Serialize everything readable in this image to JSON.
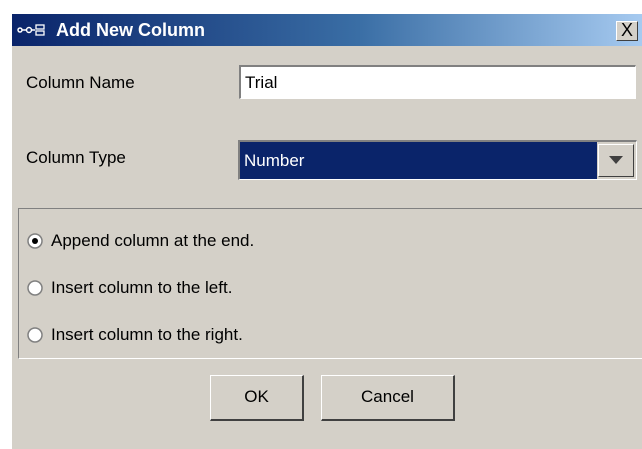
{
  "window": {
    "title": "Add New Column",
    "close_label": "X",
    "title_icon": "column-icon"
  },
  "form": {
    "name_label": "Column Name",
    "name_value": "Trial",
    "type_label": "Column Type",
    "type_value": "Number",
    "dropdown_icon": "chevron-down-icon"
  },
  "position": {
    "options": [
      {
        "label": "Append column at the end.",
        "selected": true
      },
      {
        "label": "Insert column to the left.",
        "selected": false
      },
      {
        "label": "Insert column to the right.",
        "selected": false
      }
    ]
  },
  "buttons": {
    "ok_label": "OK",
    "cancel_label": "Cancel"
  },
  "colors": {
    "titlebar_start": "#0a246a",
    "titlebar_end": "#a6caf0",
    "dialog_bg": "#d4d0c8",
    "selection_bg": "#0a246a"
  }
}
